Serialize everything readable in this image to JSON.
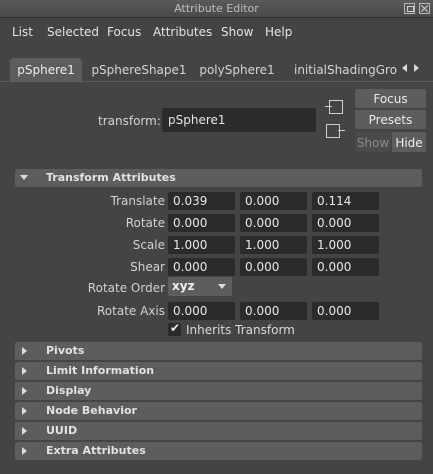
{
  "window": {
    "title": "Attribute Editor"
  },
  "menu": [
    "List",
    "Selected",
    "Focus",
    "Attributes",
    "Show",
    "Help"
  ],
  "tabs": [
    {
      "label": "pSphere1",
      "active": true
    },
    {
      "label": "pSphereShape1",
      "active": false
    },
    {
      "label": "polySphere1",
      "active": false
    },
    {
      "label": "initialShadingGroup",
      "active": false
    }
  ],
  "node": {
    "type_label": "transform:",
    "name": "pSphere1"
  },
  "buttons": {
    "focus": "Focus",
    "presets": "Presets",
    "show": "Show",
    "hide": "Hide"
  },
  "transform_section": {
    "title": "Transform Attributes",
    "expanded": true,
    "translate": {
      "label": "Translate",
      "values": [
        "0.039",
        "0.000",
        "0.114"
      ]
    },
    "rotate": {
      "label": "Rotate",
      "values": [
        "0.000",
        "0.000",
        "0.000"
      ]
    },
    "scale": {
      "label": "Scale",
      "values": [
        "1.000",
        "1.000",
        "1.000"
      ]
    },
    "shear": {
      "label": "Shear",
      "values": [
        "0.000",
        "0.000",
        "0.000"
      ]
    },
    "rotate_order": {
      "label": "Rotate Order",
      "value": "xyz"
    },
    "rotate_axis": {
      "label": "Rotate Axis",
      "values": [
        "0.000",
        "0.000",
        "0.000"
      ]
    },
    "inherits_transform": {
      "label": "Inherits Transform",
      "checked": true
    }
  },
  "collapsed_sections": [
    "Pivots",
    "Limit Information",
    "Display",
    "Node Behavior",
    "UUID",
    "Extra Attributes"
  ],
  "colors": {
    "background": "#444444",
    "header": "#5d5d5d",
    "field": "#2b2b2b"
  },
  "icons": {
    "float": "float-window-icon",
    "close": "close-icon",
    "tab_prev": "arrow-left-icon",
    "tab_next": "arrow-right-icon"
  }
}
